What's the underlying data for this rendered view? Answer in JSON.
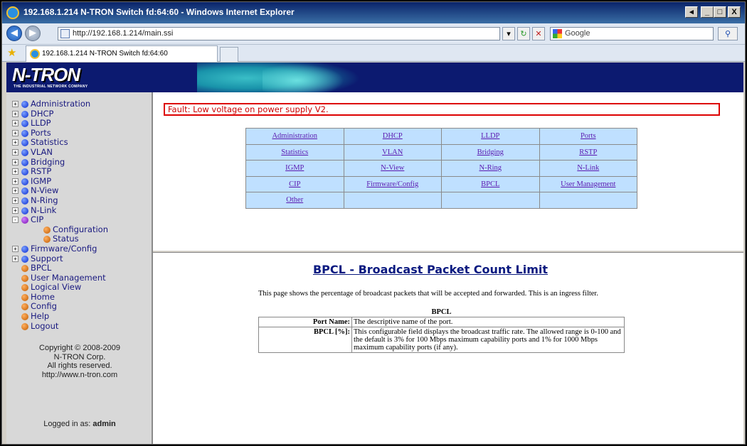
{
  "browser": {
    "window_title": "192.168.1.214 N-TRON Switch fd:64:60 - Windows Internet Explorer",
    "url": "http://192.168.1.214/main.ssi",
    "search_placeholder": "Google",
    "tab_label": "192.168.1.214 N-TRON Switch fd:64:60",
    "buttons": {
      "minimize": "_",
      "maximize": "□",
      "close": "X",
      "restore": "◂",
      "back": "◀",
      "forward": "▶",
      "refresh": "↻",
      "stop": "✕",
      "search_go": "⚲"
    }
  },
  "banner": {
    "logo": "N-TRON",
    "tagline": "THE INDUSTRIAL NETWORK COMPANY"
  },
  "sidebar": {
    "items": [
      {
        "label": "Administration",
        "expander": "+",
        "dot": "blue"
      },
      {
        "label": "DHCP",
        "expander": "+",
        "dot": "blue"
      },
      {
        "label": "LLDP",
        "expander": "+",
        "dot": "blue"
      },
      {
        "label": "Ports",
        "expander": "+",
        "dot": "blue"
      },
      {
        "label": "Statistics",
        "expander": "+",
        "dot": "blue"
      },
      {
        "label": "VLAN",
        "expander": "+",
        "dot": "blue"
      },
      {
        "label": "Bridging",
        "expander": "+",
        "dot": "blue"
      },
      {
        "label": "RSTP",
        "expander": "+",
        "dot": "blue"
      },
      {
        "label": "IGMP",
        "expander": "+",
        "dot": "blue"
      },
      {
        "label": "N-View",
        "expander": "+",
        "dot": "blue"
      },
      {
        "label": "N-Ring",
        "expander": "+",
        "dot": "blue"
      },
      {
        "label": "N-Link",
        "expander": "+",
        "dot": "blue"
      },
      {
        "label": "CIP",
        "expander": "-",
        "dot": "purple"
      },
      {
        "label": "Configuration",
        "child": true,
        "dot": "orange"
      },
      {
        "label": "Status",
        "child": true,
        "dot": "orange"
      },
      {
        "label": "Firmware/Config",
        "expander": "+",
        "dot": "blue"
      },
      {
        "label": "Support",
        "expander": "+",
        "dot": "blue"
      },
      {
        "label": "BPCL",
        "dot": "orange"
      },
      {
        "label": "User Management",
        "dot": "orange"
      },
      {
        "label": "Logical View",
        "dot": "orange"
      },
      {
        "label": "Home",
        "dot": "orange"
      },
      {
        "label": "Config",
        "dot": "orange"
      },
      {
        "label": "Help",
        "dot": "orange"
      },
      {
        "label": "Logout",
        "dot": "orange"
      }
    ],
    "copyright": [
      "Copyright © 2008-2009",
      "N-TRON Corp.",
      "All rights reserved.",
      "http://www.n-tron.com"
    ],
    "logged_in_prefix": "Logged in as:",
    "logged_in_user": "admin"
  },
  "fault": "Fault:  Low voltage on power supply V2.",
  "menu": [
    [
      "Administration",
      "DHCP",
      "LLDP",
      "Ports"
    ],
    [
      "Statistics",
      "VLAN",
      "Bridging",
      "RSTP"
    ],
    [
      "IGMP",
      "N-View",
      "N-Ring",
      "N-Link"
    ],
    [
      "CIP",
      "Firmware/Config",
      "BPCL",
      "User Management"
    ],
    [
      "Other",
      "",
      "",
      ""
    ]
  ],
  "help": {
    "title": "BPCL - Broadcast Packet Count Limit",
    "description": "This page shows the percentage of broadcast packets that will be accepted and forwarded. This is an ingress filter.",
    "table_title": "BPCL",
    "rows": [
      {
        "key": "Port Name:",
        "value": "The descriptive name of the port."
      },
      {
        "key": "BPCL [%]:",
        "value": "This configurable field displays the broadcast traffic rate. The allowed range is 0-100 and the default is 3% for 100 Mbps maximum capability ports and 1% for 1000 Mbps maximum capability ports (if any)."
      }
    ]
  },
  "colors": {
    "banner": "#0c1a70",
    "menu_cell": "#bfe0ff",
    "fault": "#cc0000",
    "link": "#5a1ab0"
  }
}
